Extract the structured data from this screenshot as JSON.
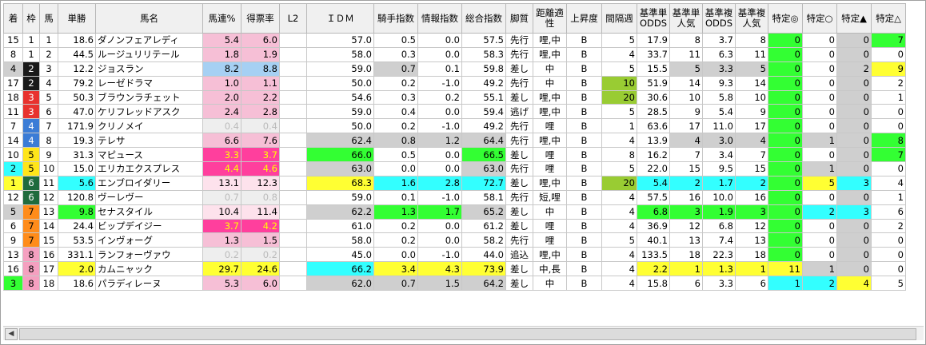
{
  "colors": {
    "pink": "#f6bfd6",
    "pink_light": "#fde2ec",
    "blue": "#a6d0f3",
    "magenta": "#ff3f9d",
    "gray_light": "#eeeeee",
    "gray": "#cfcfcf",
    "green": "#33ff33",
    "yellow": "#ffff33",
    "cyan": "#33ffff",
    "olive": "#99cc33",
    "waku1": "#ffffff",
    "waku2": "#1a1a1a",
    "waku3": "#e8322e",
    "waku4": "#3b7cd6",
    "waku5": "#ffe51a",
    "waku6": "#1f6b3d",
    "waku7": "#ff8c1a",
    "waku8": "#f5a0c0"
  },
  "headers": [
    "着",
    "枠",
    "馬",
    "単勝",
    "馬名",
    "馬連%",
    "得票率",
    "L2",
    "ＩＤＭ",
    "騎手指数",
    "情報指数",
    "総合指数",
    "脚質",
    "距離適性",
    "上昇度",
    "間隔週",
    "基準単ODDS",
    "基準単人気",
    "基準複ODDS",
    "基準複人気",
    "特定◎",
    "特定○",
    "特定▲",
    "特定△"
  ],
  "rows": [
    {
      "chaku": "15",
      "waku": "1",
      "uma": "1",
      "tansho": "18.6",
      "name": "ダノンフェアレディ",
      "umaren": "5.4",
      "tokuhyo": "6.0",
      "l2": "",
      "idm": "57.0",
      "kishu": "0.5",
      "joho": "0.0",
      "sogo": "57.5",
      "kyakushitsu": "先行",
      "kyori": "哩,中",
      "joshodo": "B",
      "kankaku": "5",
      "kt_odds": "17.9",
      "kt_ninki": "8",
      "kf_odds": "3.7",
      "kf_ninki": "8",
      "s1": "0",
      "s2": "0",
      "s3": "0",
      "s4": "7"
    },
    {
      "chaku": "8",
      "waku": "1",
      "uma": "2",
      "tansho": "44.5",
      "name": "ルージュリリテール",
      "umaren": "1.8",
      "tokuhyo": "1.9",
      "l2": "",
      "idm": "58.0",
      "kishu": "0.3",
      "joho": "0.0",
      "sogo": "58.3",
      "kyakushitsu": "先行",
      "kyori": "哩,中",
      "joshodo": "B",
      "kankaku": "4",
      "kt_odds": "33.7",
      "kt_ninki": "11",
      "kf_odds": "6.3",
      "kf_ninki": "11",
      "s1": "0",
      "s2": "0",
      "s3": "0",
      "s4": "0"
    },
    {
      "chaku": "4",
      "waku": "2",
      "uma": "3",
      "tansho": "12.2",
      "name": "ジョスラン",
      "umaren": "8.2",
      "tokuhyo": "8.8",
      "l2": "",
      "idm": "59.0",
      "kishu": "0.7",
      "joho": "0.1",
      "sogo": "59.8",
      "kyakushitsu": "差し",
      "kyori": "中",
      "joshodo": "B",
      "kankaku": "5",
      "kt_odds": "15.5",
      "kt_ninki": "5",
      "kf_odds": "3.3",
      "kf_ninki": "5",
      "s1": "0",
      "s2": "0",
      "s3": "2",
      "s4": "9"
    },
    {
      "chaku": "17",
      "waku": "2",
      "uma": "4",
      "tansho": "79.2",
      "name": "レーゼドラマ",
      "umaren": "1.0",
      "tokuhyo": "1.1",
      "l2": "",
      "idm": "50.0",
      "kishu": "0.2",
      "joho": "-1.0",
      "sogo": "49.2",
      "kyakushitsu": "先行",
      "kyori": "中",
      "joshodo": "B",
      "kankaku": "10",
      "kt_odds": "51.9",
      "kt_ninki": "14",
      "kf_odds": "9.3",
      "kf_ninki": "14",
      "s1": "0",
      "s2": "0",
      "s3": "0",
      "s4": "2"
    },
    {
      "chaku": "18",
      "waku": "3",
      "uma": "5",
      "tansho": "50.3",
      "name": "ブラウンラチェット",
      "umaren": "2.0",
      "tokuhyo": "2.2",
      "l2": "",
      "idm": "54.6",
      "kishu": "0.3",
      "joho": "0.2",
      "sogo": "55.1",
      "kyakushitsu": "差し",
      "kyori": "哩,中",
      "joshodo": "B",
      "kankaku": "20",
      "kt_odds": "30.6",
      "kt_ninki": "10",
      "kf_odds": "5.8",
      "kf_ninki": "10",
      "s1": "0",
      "s2": "0",
      "s3": "0",
      "s4": "1"
    },
    {
      "chaku": "11",
      "waku": "3",
      "uma": "6",
      "tansho": "47.0",
      "name": "ケリフレッドアスク",
      "umaren": "2.4",
      "tokuhyo": "2.8",
      "l2": "",
      "idm": "59.0",
      "kishu": "0.4",
      "joho": "0.0",
      "sogo": "59.4",
      "kyakushitsu": "逃げ",
      "kyori": "哩,中",
      "joshodo": "B",
      "kankaku": "5",
      "kt_odds": "28.5",
      "kt_ninki": "9",
      "kf_odds": "5.4",
      "kf_ninki": "9",
      "s1": "0",
      "s2": "0",
      "s3": "0",
      "s4": "0"
    },
    {
      "chaku": "7",
      "waku": "4",
      "uma": "7",
      "tansho": "171.9",
      "name": "クリノメイ",
      "umaren": "0.4",
      "tokuhyo": "0.4",
      "l2": "",
      "idm": "50.0",
      "kishu": "0.2",
      "joho": "-1.0",
      "sogo": "49.2",
      "kyakushitsu": "先行",
      "kyori": "哩",
      "joshodo": "B",
      "kankaku": "1",
      "kt_odds": "63.6",
      "kt_ninki": "17",
      "kf_odds": "11.0",
      "kf_ninki": "17",
      "s1": "0",
      "s2": "0",
      "s3": "0",
      "s4": "0"
    },
    {
      "chaku": "14",
      "waku": "4",
      "uma": "8",
      "tansho": "19.3",
      "name": "テレサ",
      "umaren": "6.6",
      "tokuhyo": "7.6",
      "l2": "",
      "idm": "62.4",
      "kishu": "0.8",
      "joho": "1.2",
      "sogo": "64.4",
      "kyakushitsu": "先行",
      "kyori": "哩,中",
      "joshodo": "B",
      "kankaku": "4",
      "kt_odds": "13.9",
      "kt_ninki": "4",
      "kf_odds": "3.0",
      "kf_ninki": "4",
      "s1": "0",
      "s2": "1",
      "s3": "0",
      "s4": "8"
    },
    {
      "chaku": "10",
      "waku": "5",
      "uma": "9",
      "tansho": "31.3",
      "name": "マピュース",
      "umaren": "3.3",
      "tokuhyo": "3.7",
      "l2": "",
      "idm": "66.0",
      "kishu": "0.5",
      "joho": "0.0",
      "sogo": "66.5",
      "kyakushitsu": "差し",
      "kyori": "哩",
      "joshodo": "B",
      "kankaku": "8",
      "kt_odds": "16.2",
      "kt_ninki": "7",
      "kf_odds": "3.4",
      "kf_ninki": "7",
      "s1": "0",
      "s2": "0",
      "s3": "0",
      "s4": "7"
    },
    {
      "chaku": "2",
      "waku": "5",
      "uma": "10",
      "tansho": "15.0",
      "name": "エリカエクスプレス",
      "umaren": "4.4",
      "tokuhyo": "4.6",
      "l2": "",
      "idm": "63.0",
      "kishu": "0.0",
      "joho": "0.0",
      "sogo": "63.0",
      "kyakushitsu": "先行",
      "kyori": "哩",
      "joshodo": "B",
      "kankaku": "5",
      "kt_odds": "22.0",
      "kt_ninki": "15",
      "kf_odds": "9.5",
      "kf_ninki": "15",
      "s1": "0",
      "s2": "1",
      "s3": "0",
      "s4": "0"
    },
    {
      "chaku": "1",
      "waku": "6",
      "uma": "11",
      "tansho": "5.6",
      "name": "エンブロイダリー",
      "umaren": "13.1",
      "tokuhyo": "12.3",
      "l2": "",
      "idm": "68.3",
      "kishu": "1.6",
      "joho": "2.8",
      "sogo": "72.7",
      "kyakushitsu": "差し",
      "kyori": "哩,中",
      "joshodo": "B",
      "kankaku": "20",
      "kt_odds": "5.4",
      "kt_ninki": "2",
      "kf_odds": "1.7",
      "kf_ninki": "2",
      "s1": "0",
      "s2": "5",
      "s3": "3",
      "s4": "4"
    },
    {
      "chaku": "12",
      "waku": "6",
      "uma": "12",
      "tansho": "120.8",
      "name": "ヴーレヴー",
      "umaren": "0.7",
      "tokuhyo": "0.8",
      "l2": "",
      "idm": "59.0",
      "kishu": "0.1",
      "joho": "-1.0",
      "sogo": "58.1",
      "kyakushitsu": "先行",
      "kyori": "短,哩",
      "joshodo": "B",
      "kankaku": "4",
      "kt_odds": "57.5",
      "kt_ninki": "16",
      "kf_odds": "10.0",
      "kf_ninki": "16",
      "s1": "0",
      "s2": "0",
      "s3": "0",
      "s4": "1"
    },
    {
      "chaku": "5",
      "waku": "7",
      "uma": "13",
      "tansho": "9.8",
      "name": "セナスタイル",
      "umaren": "10.4",
      "tokuhyo": "11.4",
      "l2": "",
      "idm": "62.2",
      "kishu": "1.3",
      "joho": "1.7",
      "sogo": "65.2",
      "kyakushitsu": "差し",
      "kyori": "中",
      "joshodo": "B",
      "kankaku": "4",
      "kt_odds": "6.8",
      "kt_ninki": "3",
      "kf_odds": "1.9",
      "kf_ninki": "3",
      "s1": "0",
      "s2": "2",
      "s3": "3",
      "s4": "6"
    },
    {
      "chaku": "6",
      "waku": "7",
      "uma": "14",
      "tansho": "24.4",
      "name": "ビップデイジー",
      "umaren": "3.7",
      "tokuhyo": "4.2",
      "l2": "",
      "idm": "61.0",
      "kishu": "0.2",
      "joho": "0.0",
      "sogo": "61.2",
      "kyakushitsu": "差し",
      "kyori": "哩",
      "joshodo": "B",
      "kankaku": "4",
      "kt_odds": "36.9",
      "kt_ninki": "12",
      "kf_odds": "6.8",
      "kf_ninki": "12",
      "s1": "0",
      "s2": "0",
      "s3": "0",
      "s4": "2"
    },
    {
      "chaku": "9",
      "waku": "7",
      "uma": "15",
      "tansho": "53.5",
      "name": "インヴォーグ",
      "umaren": "1.3",
      "tokuhyo": "1.5",
      "l2": "",
      "idm": "58.0",
      "kishu": "0.2",
      "joho": "0.0",
      "sogo": "58.2",
      "kyakushitsu": "先行",
      "kyori": "哩",
      "joshodo": "B",
      "kankaku": "5",
      "kt_odds": "40.1",
      "kt_ninki": "13",
      "kf_odds": "7.4",
      "kf_ninki": "13",
      "s1": "0",
      "s2": "0",
      "s3": "0",
      "s4": "0"
    },
    {
      "chaku": "13",
      "waku": "8",
      "uma": "16",
      "tansho": "331.1",
      "name": "ランフォーヴァウ",
      "umaren": "0.2",
      "tokuhyo": "0.2",
      "l2": "",
      "idm": "45.0",
      "kishu": "0.0",
      "joho": "-1.0",
      "sogo": "44.0",
      "kyakushitsu": "追込",
      "kyori": "哩,中",
      "joshodo": "B",
      "kankaku": "4",
      "kt_odds": "133.5",
      "kt_ninki": "18",
      "kf_odds": "22.3",
      "kf_ninki": "18",
      "s1": "0",
      "s2": "0",
      "s3": "0",
      "s4": "0"
    },
    {
      "chaku": "16",
      "waku": "8",
      "uma": "17",
      "tansho": "2.0",
      "name": "カムニャック",
      "umaren": "29.7",
      "tokuhyo": "24.6",
      "l2": "",
      "idm": "66.2",
      "kishu": "3.4",
      "joho": "4.3",
      "sogo": "73.9",
      "kyakushitsu": "差し",
      "kyori": "中,長",
      "joshodo": "B",
      "kankaku": "4",
      "kt_odds": "2.2",
      "kt_ninki": "1",
      "kf_odds": "1.3",
      "kf_ninki": "1",
      "s1": "11",
      "s2": "1",
      "s3": "0",
      "s4": "0"
    },
    {
      "chaku": "3",
      "waku": "8",
      "uma": "18",
      "tansho": "18.6",
      "name": "パラディレーヌ",
      "umaren": "5.3",
      "tokuhyo": "6.0",
      "l2": "",
      "idm": "62.0",
      "kishu": "0.7",
      "joho": "1.5",
      "sogo": "64.2",
      "kyakushitsu": "差し",
      "kyori": "中",
      "joshodo": "B",
      "kankaku": "4",
      "kt_odds": "15.8",
      "kt_ninki": "6",
      "kf_odds": "3.3",
      "kf_ninki": "6",
      "s1": "1",
      "s2": "2",
      "s3": "4",
      "s4": "5"
    }
  ],
  "scrollbar": {
    "left_arrow": "◀"
  }
}
